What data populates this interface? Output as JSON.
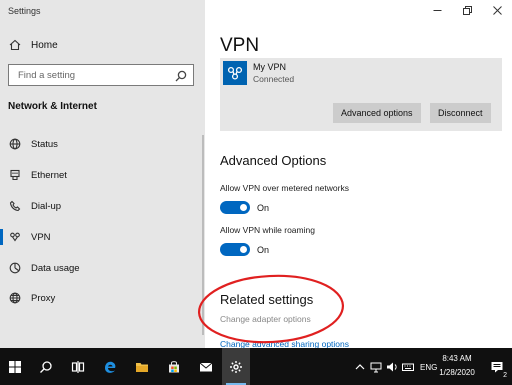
{
  "window": {
    "title": "Settings"
  },
  "sidebar": {
    "home": "Home",
    "search_placeholder": "Find a setting",
    "section_title": "Network & Internet",
    "items": [
      {
        "label": "Status",
        "icon": "globe-icon"
      },
      {
        "label": "Ethernet",
        "icon": "ethernet-icon"
      },
      {
        "label": "Dial-up",
        "icon": "phone-icon"
      },
      {
        "label": "VPN",
        "icon": "vpn-icon",
        "active": true
      },
      {
        "label": "Data usage",
        "icon": "data-usage-icon"
      },
      {
        "label": "Proxy",
        "icon": "proxy-globe-icon"
      }
    ]
  },
  "main": {
    "title": "VPN",
    "connection": {
      "name": "My VPN",
      "status": "Connected",
      "advanced_button": "Advanced options",
      "disconnect_button": "Disconnect"
    },
    "advanced": {
      "heading": "Advanced Options",
      "metered_label": "Allow VPN over metered networks",
      "metered_state": "On",
      "roaming_label": "Allow VPN while roaming",
      "roaming_state": "On"
    },
    "related": {
      "heading": "Related settings",
      "adapter_link": "Change adapter options",
      "sharing_link": "Change advanced sharing options"
    }
  },
  "taskbar": {
    "lang": "ENG",
    "time": "8:43 AM",
    "date": "1/28/2020",
    "notification_count": "2"
  },
  "colors": {
    "accent": "#0067c0",
    "annotation": "#e02020",
    "link": "#0067c0",
    "muted_link": "#888888"
  }
}
